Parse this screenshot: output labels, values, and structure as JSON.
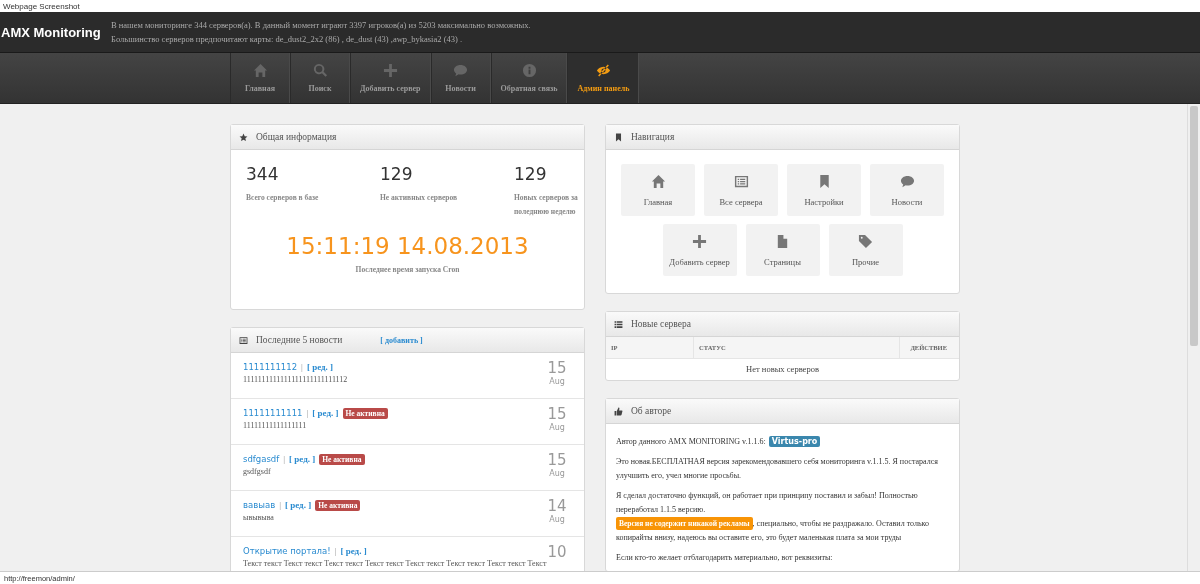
{
  "window": {
    "title": "Webpage Screenshot"
  },
  "header": {
    "brand": "AMX Monitoring",
    "stats_line": "В нашем мониторинге 344 серверов(а). В данный момент играют 3397 игроков(а) из 5203 максимально возможных.",
    "maps_line": "Большинство серверов предпочитают карты: de_dust2_2x2 (86) , de_dust (43) ,awp_bykasia2 (43) ."
  },
  "nav": [
    {
      "kind": "home",
      "label": "Главная",
      "selected": false
    },
    {
      "kind": "search",
      "label": "Поиск",
      "selected": false
    },
    {
      "kind": "plus",
      "label": "Добавить сервер",
      "selected": false
    },
    {
      "kind": "comment",
      "label": "Новости",
      "selected": false
    },
    {
      "kind": "info",
      "label": "Обратная связь",
      "selected": false
    },
    {
      "kind": "eye-slash",
      "label": "Админ панель",
      "selected": true
    }
  ],
  "info_panel": {
    "title": "Общая информация",
    "stats": [
      {
        "value": "344",
        "label": "Всего серверов в базе"
      },
      {
        "value": "129",
        "label": "Не активных серверов"
      },
      {
        "value": "129",
        "label": "Новых серверов за поледнюю неделю"
      }
    ],
    "cron_time": "15:11:19 14.08.2013",
    "cron_label": "Последнее время запуска Cron"
  },
  "news_panel": {
    "title": "Последние 5 новости",
    "add_link": "[ добавить ]",
    "items": [
      {
        "title": "1111111112",
        "separator": "|",
        "edit_link": "[ ред. ]",
        "body": "1111111111111111111111111112",
        "day": "15",
        "month": "Aug"
      },
      {
        "title": "11111111111",
        "separator": "|",
        "edit_link": "[ ред. ]",
        "badge": "Не активна",
        "body": "11111111111111111",
        "day": "15",
        "month": "Aug"
      },
      {
        "title": "sdfgasdf",
        "separator": "|",
        "edit_link": "[ ред. ]",
        "badge": "Не активна",
        "body": "gsdfgsdf",
        "day": "15",
        "month": "Aug"
      },
      {
        "title": "вавыав",
        "separator": "|",
        "edit_link": "[ ред. ]",
        "badge": "Не активна",
        "body": "ывывыва",
        "day": "14",
        "month": "Aug"
      },
      {
        "title": "Открытие портала!",
        "separator": "|",
        "edit_link": "[ ред. ]",
        "body": "Текст текст Текст текст Текст текст Текст текст Текст текст Текст текст Текст текст Текст",
        "day": "10"
      }
    ]
  },
  "nav_panel": {
    "title": "Навигация",
    "rows": [
      [
        {
          "kind": "home",
          "label": "Главная"
        },
        {
          "kind": "list",
          "label": "Все сервера"
        },
        {
          "kind": "bookmark",
          "label": "Настройки"
        },
        {
          "kind": "comment",
          "label": "Новости"
        }
      ],
      [
        {
          "kind": "plus",
          "label": "Добавить сервер"
        },
        {
          "kind": "file",
          "label": "Страницы"
        },
        {
          "kind": "tag",
          "label": "Прочие"
        }
      ]
    ]
  },
  "servers_panel": {
    "title": "Новые сервера",
    "columns": [
      "IP",
      "СТАТУС",
      "ДЕЙСТВИЕ"
    ],
    "empty_text": "Нет новых серверов"
  },
  "about_panel": {
    "title": "Об авторе",
    "author_text": "Автор данного AMX MONITORING v.1.1.6:",
    "author_badge": "Virtus-pro",
    "paragraph_1": "Это новая.БЕСПЛАТНАЯ версия зарекомендовавшего себя мониторинга v.1.1.5. Я постарался улучшить его, учел многие просьбы.",
    "paragraph_2": "Я сделал достаточно функций, он работает при принципу поставил и забыл! Полностью переработал 1.1.5 версию.",
    "ad_badge": "Версия не содержит никакой рекламы",
    "paragraph_3": ", специально, чтобы не раздражало. Оставил только",
    "paragraph_3_cont": "копирайты внизу, надеюсь вы оставите его, это будет маленькая плата за мои труды",
    "paragraph_4": "Если кто-то желает отблагодарить материально, вот реквизиты:"
  },
  "status_bar": {
    "url": "http://freemon/admin/"
  }
}
